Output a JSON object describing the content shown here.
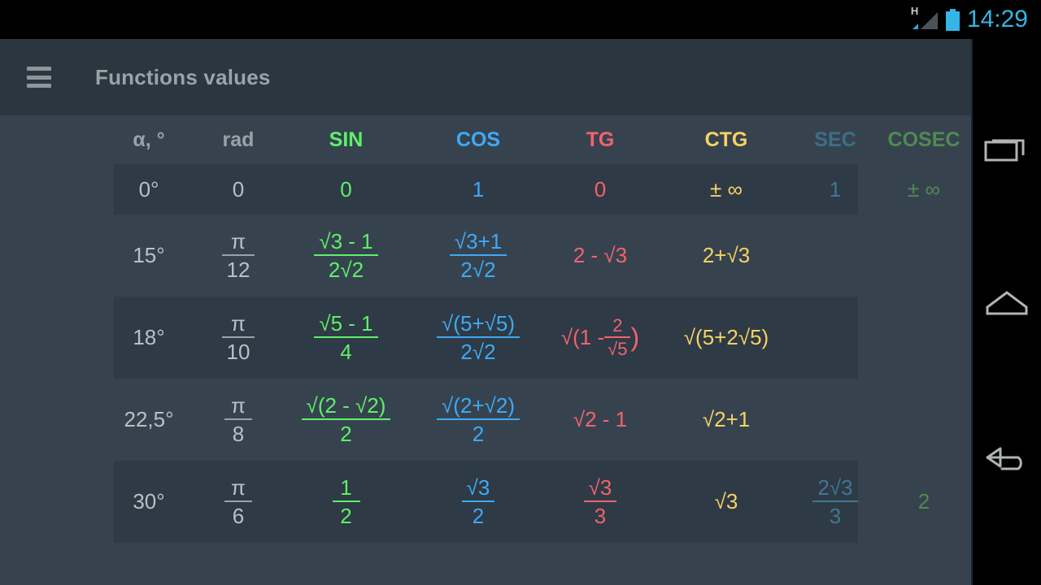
{
  "status_bar": {
    "network_type": "H",
    "signal_icon": "signal-triangle-icon",
    "battery_icon": "battery-full-icon",
    "time": "14:29",
    "accent_color": "#33b5e5"
  },
  "toolbar": {
    "menu_icon": "hamburger-menu-icon",
    "title": "Functions values"
  },
  "nav_bar": {
    "recents_label": "recents",
    "home_label": "home",
    "back_label": "back"
  },
  "colors": {
    "background": "#36434f",
    "toolbar": "#2c363e",
    "row_stripe": "#2e3a45",
    "sin": "#5ef069",
    "cos": "#3fa9f5",
    "tg": "#f2636e",
    "ctg": "#f7d264",
    "sec": "#3f7893",
    "cosec": "#4f8a53",
    "neutral": "#b8c0c6"
  },
  "table": {
    "headers": {
      "angle": "α, °",
      "rad": "rad",
      "sin": "SIN",
      "cos": "COS",
      "tg": "TG",
      "ctg": "CTG",
      "sec": "SEC",
      "cosec": "COSEC"
    },
    "rows": [
      {
        "angle": "0°",
        "rad": "0",
        "sin": "0",
        "cos": "1",
        "tg": "0",
        "ctg": "± ∞",
        "sec": "1",
        "cosec": "± ∞"
      },
      {
        "angle": "15°",
        "rad_num": "π",
        "rad_den": "12",
        "sin_num": "√3 - 1",
        "sin_den": "2√2",
        "cos_num": "√3+1",
        "cos_den": "2√2",
        "tg": "2 - √3",
        "ctg": "2+√3",
        "sec": "",
        "cosec": ""
      },
      {
        "angle": "18°",
        "rad_num": "π",
        "rad_den": "10",
        "sin_num": "√5 - 1",
        "sin_den": "4",
        "cos_num": "√(5+√5)",
        "cos_den": "2√2",
        "tg_prefix": "√(1 - ",
        "tg_frac_num": "2",
        "tg_frac_den": "√5",
        "tg_suffix": ")",
        "ctg": "√(5+2√5)",
        "sec": "",
        "cosec": ""
      },
      {
        "angle": "22,5°",
        "rad_num": "π",
        "rad_den": "8",
        "sin_num": "√(2 - √2)",
        "sin_den": "2",
        "cos_num": "√(2+√2)",
        "cos_den": "2",
        "tg": "√2 - 1",
        "ctg": "√2+1",
        "sec": "",
        "cosec": ""
      },
      {
        "angle": "30°",
        "rad_num": "π",
        "rad_den": "6",
        "sin_num": "1",
        "sin_den": "2",
        "cos_num": "√3",
        "cos_den": "2",
        "tg_num": "√3",
        "tg_den": "3",
        "ctg": "√3",
        "sec_num": "2√3",
        "sec_den": "3",
        "cosec": "2"
      }
    ]
  }
}
